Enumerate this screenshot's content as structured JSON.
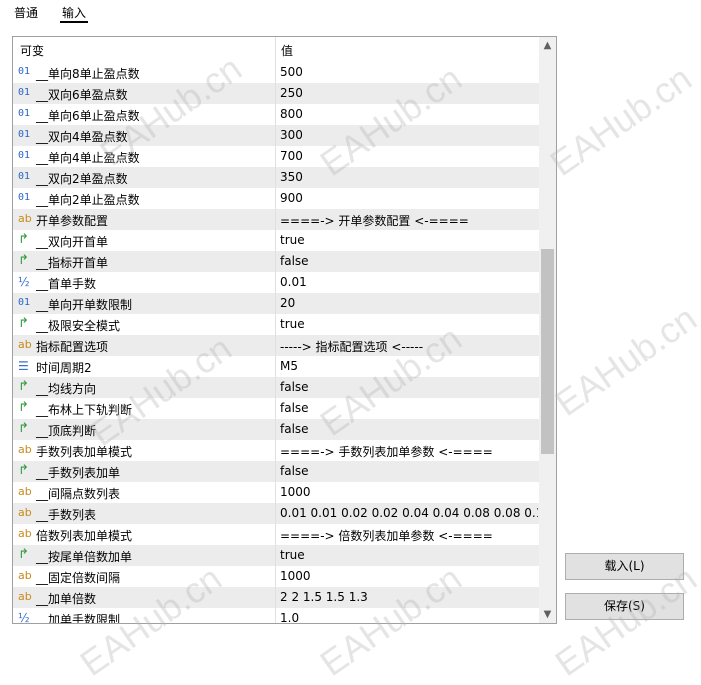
{
  "tabs": [
    "普通",
    "输入"
  ],
  "grid": {
    "headers": [
      "可变",
      "值"
    ],
    "rows": [
      {
        "type": "int",
        "icon_text": "01",
        "icon_name": "integer-type-icon",
        "name": "__单向8单止盈点数",
        "value": "500"
      },
      {
        "type": "int",
        "icon_text": "01",
        "icon_name": "integer-type-icon",
        "name": "__双向6单盈点数",
        "value": "250"
      },
      {
        "type": "int",
        "icon_text": "01",
        "icon_name": "integer-type-icon",
        "name": "__单向6单止盈点数",
        "value": "800"
      },
      {
        "type": "int",
        "icon_text": "01",
        "icon_name": "integer-type-icon",
        "name": "__双向4单盈点数",
        "value": "300"
      },
      {
        "type": "int",
        "icon_text": "01",
        "icon_name": "integer-type-icon",
        "name": "__单向4单止盈点数",
        "value": "700"
      },
      {
        "type": "int",
        "icon_text": "01",
        "icon_name": "integer-type-icon",
        "name": "__双向2单盈点数",
        "value": "350"
      },
      {
        "type": "int",
        "icon_text": "01",
        "icon_name": "integer-type-icon",
        "name": "__单向2单止盈点数",
        "value": "900"
      },
      {
        "type": "str",
        "icon_text": "ab",
        "icon_name": "string-type-icon",
        "name": "开单参数配置",
        "value": "====-> 开单参数配置 <-===="
      },
      {
        "type": "bool",
        "icon_text": "↱",
        "icon_name": "boolean-type-icon",
        "name": "__双向开首单",
        "value": "true"
      },
      {
        "type": "bool",
        "icon_text": "↱",
        "icon_name": "boolean-type-icon",
        "name": "__指标开首单",
        "value": "false"
      },
      {
        "type": "dbl",
        "icon_text": "½",
        "icon_name": "double-type-icon",
        "name": "__首单手数",
        "value": "0.01"
      },
      {
        "type": "int",
        "icon_text": "01",
        "icon_name": "integer-type-icon",
        "name": "__单向开单数限制",
        "value": "20"
      },
      {
        "type": "bool",
        "icon_text": "↱",
        "icon_name": "boolean-type-icon",
        "name": "__极限安全模式",
        "value": "true"
      },
      {
        "type": "str",
        "icon_text": "ab",
        "icon_name": "string-type-icon",
        "name": "指标配置选项",
        "value": "-----> 指标配置选项 <-----"
      },
      {
        "type": "enum",
        "icon_text": "☰",
        "icon_name": "enum-type-icon",
        "name": "时间周期2",
        "value": "M5"
      },
      {
        "type": "bool",
        "icon_text": "↱",
        "icon_name": "boolean-type-icon",
        "name": "__均线方向",
        "value": "false"
      },
      {
        "type": "bool",
        "icon_text": "↱",
        "icon_name": "boolean-type-icon",
        "name": "__布林上下轨判断",
        "value": "false"
      },
      {
        "type": "bool",
        "icon_text": "↱",
        "icon_name": "boolean-type-icon",
        "name": "__顶底判断",
        "value": "false"
      },
      {
        "type": "str",
        "icon_text": "ab",
        "icon_name": "string-type-icon",
        "name": "手数列表加单模式",
        "value": "====-> 手数列表加单参数 <-===="
      },
      {
        "type": "bool",
        "icon_text": "↱",
        "icon_name": "boolean-type-icon",
        "name": "__手数列表加单",
        "value": "false"
      },
      {
        "type": "str",
        "icon_text": "ab",
        "icon_name": "string-type-icon",
        "name": "__间隔点数列表",
        "value": "1000"
      },
      {
        "type": "str",
        "icon_text": "ab",
        "icon_name": "string-type-icon",
        "name": "__手数列表",
        "value": "0.01 0.01 0.02 0.02 0.04 0.04 0.08 0.08 0.1..."
      },
      {
        "type": "str",
        "icon_text": "ab",
        "icon_name": "string-type-icon",
        "name": "倍数列表加单模式",
        "value": "====-> 倍数列表加单参数 <-===="
      },
      {
        "type": "bool",
        "icon_text": "↱",
        "icon_name": "boolean-type-icon",
        "name": "__按尾单倍数加单",
        "value": "true"
      },
      {
        "type": "str",
        "icon_text": "ab",
        "icon_name": "string-type-icon",
        "name": "__固定倍数间隔",
        "value": "1000"
      },
      {
        "type": "str",
        "icon_text": "ab",
        "icon_name": "string-type-icon",
        "name": "__加单倍数",
        "value": "2 2 1.5 1.5 1.3"
      },
      {
        "type": "dbl",
        "icon_text": "½",
        "icon_name": "double-type-icon",
        "name": "__加单手数限制",
        "value": "1.0"
      }
    ]
  },
  "buttons": {
    "load": "载入(L)",
    "save": "保存(S)"
  },
  "watermark": "EAHub.cn",
  "colors": {
    "alt_row": "#ececec",
    "border": "#a0a0a0",
    "button_bg": "#e1e1e1"
  }
}
